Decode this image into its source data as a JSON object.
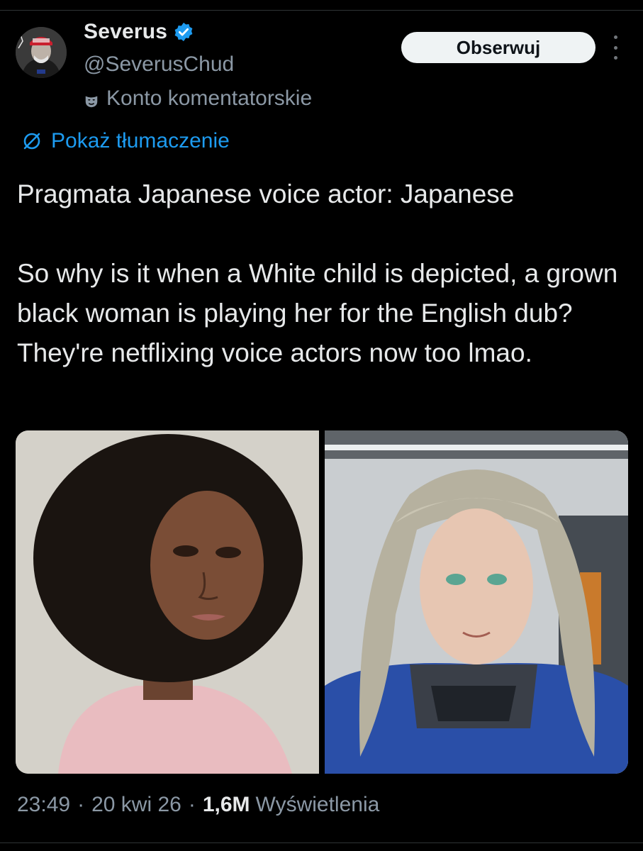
{
  "author": {
    "display_name": "Severus",
    "handle": "@SeverusChud",
    "account_label": "Konto komentatorskie",
    "verified_icon": "verified-badge-icon",
    "badge_color": "#1d9bf0"
  },
  "actions": {
    "follow_label": "Obserwuj",
    "more_icon": "more-vertical-icon"
  },
  "translate": {
    "label": "Pokaż tłumaczenie",
    "icon": "translate-icon"
  },
  "tweet": {
    "text": "Pragmata Japanese voice actor: Japanese\n\nSo why is it when a White child is depicted, a grown black woman is playing her for the English dub? They're netflixing voice actors now too lmao."
  },
  "media": [
    {
      "kind": "photo"
    },
    {
      "kind": "photo"
    }
  ],
  "meta": {
    "time": "23:49",
    "date": "20 kwi 26",
    "views_count": "1,6M",
    "views_label": "Wyświetlenia",
    "separator": "·"
  }
}
